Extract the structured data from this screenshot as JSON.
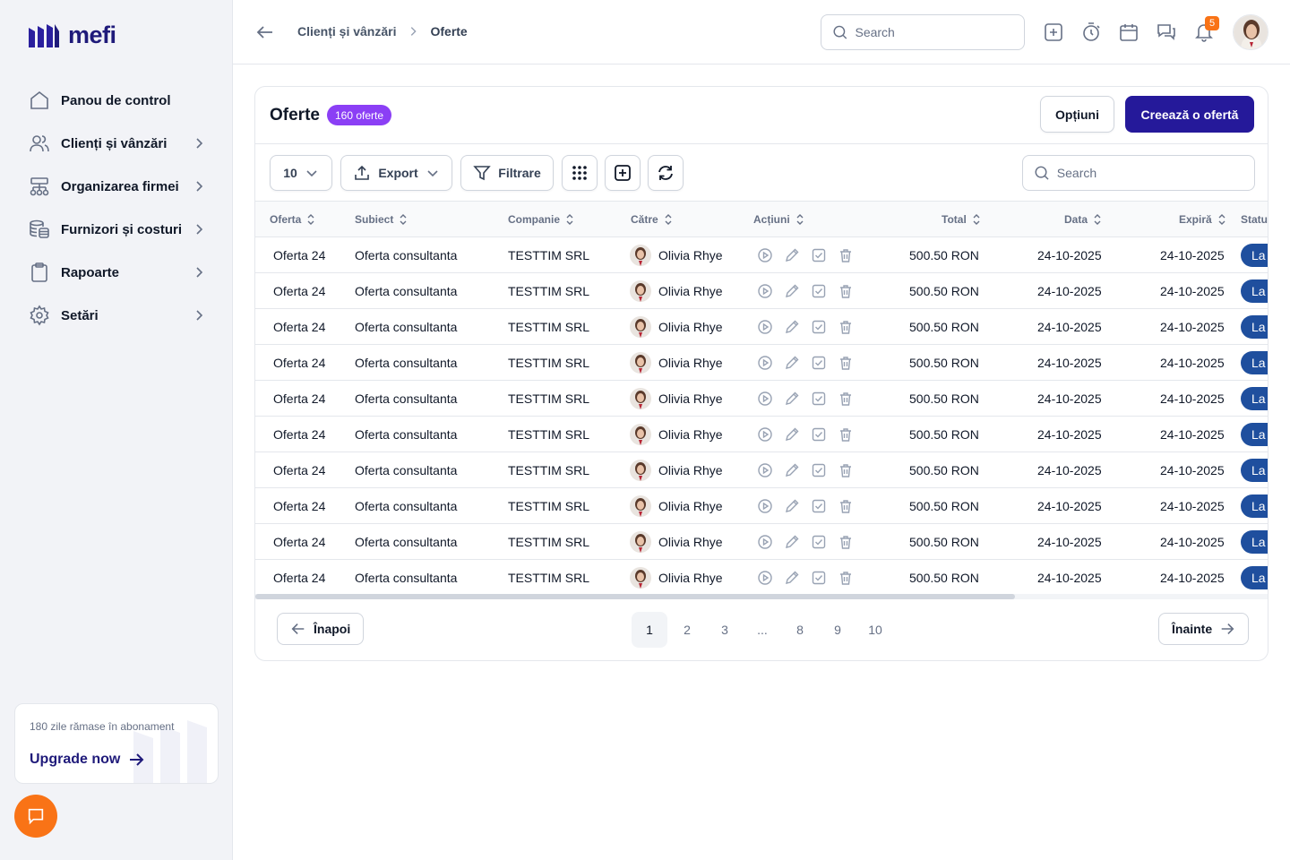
{
  "app": {
    "logo_text": "mefi"
  },
  "sidebar": {
    "items": [
      {
        "label": "Panou de control",
        "icon": "home-icon",
        "has_chevron": false
      },
      {
        "label": "Clienți și vânzări",
        "icon": "users-icon",
        "has_chevron": true
      },
      {
        "label": "Organizarea firmei",
        "icon": "org-chart-icon",
        "has_chevron": true
      },
      {
        "label": "Furnizori și costuri",
        "icon": "database-coins-icon",
        "has_chevron": true
      },
      {
        "label": "Rapoarte",
        "icon": "clipboard-icon",
        "has_chevron": true
      },
      {
        "label": "Setări",
        "icon": "gear-icon",
        "has_chevron": true
      }
    ],
    "upgrade": {
      "days_text": "180 zile rămase în abonament",
      "link_label": "Upgrade now"
    }
  },
  "header": {
    "breadcrumb": [
      "Clienți și vânzări",
      "Oferte"
    ],
    "search_placeholder": "Search",
    "notification_count": "5"
  },
  "page": {
    "title": "Oferte",
    "count_badge": "160 oferte",
    "options_label": "Opțiuni",
    "create_label": "Creează o ofertă"
  },
  "toolbar": {
    "page_size": "10",
    "export_label": "Export",
    "filter_label": "Filtrare",
    "search_placeholder": "Search"
  },
  "table": {
    "columns": [
      "Oferta",
      "Subiect",
      "Companie",
      "Către",
      "Acțiuni",
      "Total",
      "Data",
      "Expiră",
      "Statu"
    ],
    "status_label": "La",
    "rows": [
      {
        "oferta": "Oferta 24",
        "subiect": "Oferta consultanta",
        "companie": "TESTTIM SRL",
        "catre": "Olivia Rhye",
        "total": "500.50 RON",
        "data": "24-10-2025",
        "expira": "24-10-2025"
      },
      {
        "oferta": "Oferta 24",
        "subiect": "Oferta consultanta",
        "companie": "TESTTIM SRL",
        "catre": "Olivia Rhye",
        "total": "500.50 RON",
        "data": "24-10-2025",
        "expira": "24-10-2025"
      },
      {
        "oferta": "Oferta 24",
        "subiect": "Oferta consultanta",
        "companie": "TESTTIM SRL",
        "catre": "Olivia Rhye",
        "total": "500.50 RON",
        "data": "24-10-2025",
        "expira": "24-10-2025"
      },
      {
        "oferta": "Oferta 24",
        "subiect": "Oferta consultanta",
        "companie": "TESTTIM SRL",
        "catre": "Olivia Rhye",
        "total": "500.50 RON",
        "data": "24-10-2025",
        "expira": "24-10-2025"
      },
      {
        "oferta": "Oferta 24",
        "subiect": "Oferta consultanta",
        "companie": "TESTTIM SRL",
        "catre": "Olivia Rhye",
        "total": "500.50 RON",
        "data": "24-10-2025",
        "expira": "24-10-2025"
      },
      {
        "oferta": "Oferta 24",
        "subiect": "Oferta consultanta",
        "companie": "TESTTIM SRL",
        "catre": "Olivia Rhye",
        "total": "500.50 RON",
        "data": "24-10-2025",
        "expira": "24-10-2025"
      },
      {
        "oferta": "Oferta 24",
        "subiect": "Oferta consultanta",
        "companie": "TESTTIM SRL",
        "catre": "Olivia Rhye",
        "total": "500.50 RON",
        "data": "24-10-2025",
        "expira": "24-10-2025"
      },
      {
        "oferta": "Oferta 24",
        "subiect": "Oferta consultanta",
        "companie": "TESTTIM SRL",
        "catre": "Olivia Rhye",
        "total": "500.50 RON",
        "data": "24-10-2025",
        "expira": "24-10-2025"
      },
      {
        "oferta": "Oferta 24",
        "subiect": "Oferta consultanta",
        "companie": "TESTTIM SRL",
        "catre": "Olivia Rhye",
        "total": "500.50 RON",
        "data": "24-10-2025",
        "expira": "24-10-2025"
      },
      {
        "oferta": "Oferta 24",
        "subiect": "Oferta consultanta",
        "companie": "TESTTIM SRL",
        "catre": "Olivia Rhye",
        "total": "500.50 RON",
        "data": "24-10-2025",
        "expira": "24-10-2025"
      }
    ]
  },
  "pagination": {
    "prev_label": "Înapoi",
    "next_label": "Înainte",
    "pages": [
      "1",
      "2",
      "3",
      "...",
      "8",
      "9",
      "10"
    ],
    "active": "1"
  },
  "colors": {
    "brand": "#25199a",
    "badge": "#8b3ff5",
    "accent": "#f97316",
    "status": "#1f4f9e"
  }
}
